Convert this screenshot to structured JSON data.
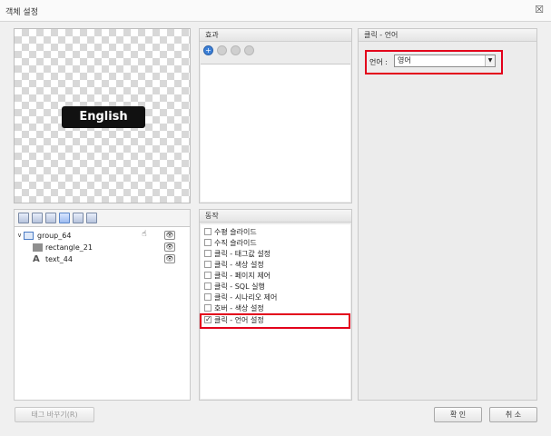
{
  "window": {
    "title": "객체 설정",
    "close_glyph": "☒"
  },
  "preview": {
    "button_text": "English"
  },
  "layers": {
    "rows": [
      {
        "label": "group_64",
        "expander": "∨"
      },
      {
        "label": "rectangle_21"
      },
      {
        "label": "text_44"
      }
    ],
    "eye_glyph": "👁",
    "hand_glyph": "☝"
  },
  "effects": {
    "title": "효과"
  },
  "actions": {
    "title": "동작",
    "items": [
      {
        "label": "수평 슬라이드",
        "checked": false
      },
      {
        "label": "수직 슬라이드",
        "checked": false
      },
      {
        "label": "클릭 - 태그값 설정",
        "checked": false
      },
      {
        "label": "클릭 - 색상 설정",
        "checked": false
      },
      {
        "label": "클릭 - 페이지 제어",
        "checked": false
      },
      {
        "label": "클릭 - SQL 실행",
        "checked": false
      },
      {
        "label": "클릭 - 시나리오 제어",
        "checked": false
      },
      {
        "label": "호버 - 색상 설정",
        "checked": false
      },
      {
        "label": "클릭 - 언어 설정",
        "checked": true
      }
    ],
    "check_glyph": "✓"
  },
  "click_language": {
    "title": "클릭 - 언어",
    "language_label": "언어 :",
    "language_value": "영어",
    "arrow_glyph": "▼"
  },
  "buttons": {
    "tag_change": "태그 바꾸기(R)",
    "ok": "확 인",
    "cancel": "취 소"
  },
  "colors": {
    "highlight": "#e3001b",
    "accent": "#3c7fd6"
  }
}
